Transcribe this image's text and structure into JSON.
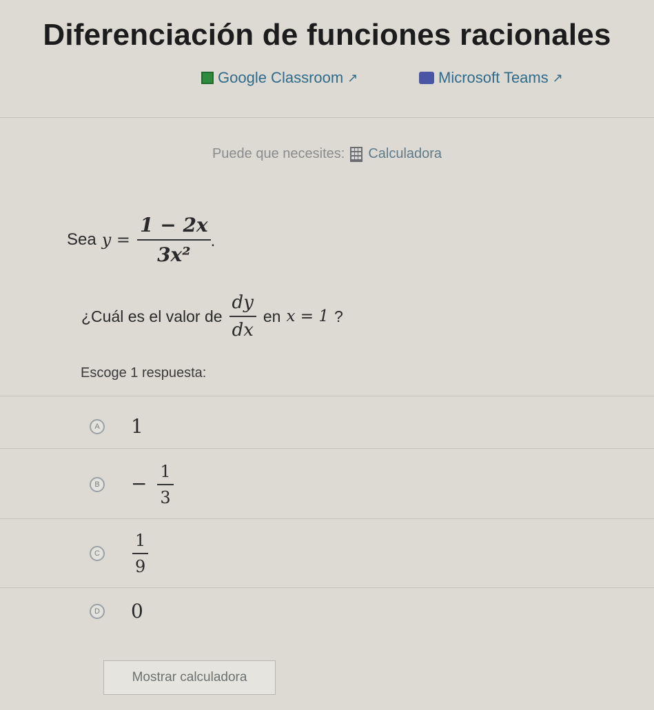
{
  "title": "Diferenciación de funciones racionales",
  "share": {
    "classroom_label": "Google Classroom",
    "teams_label": "Microsoft Teams"
  },
  "help": {
    "prefix": "Puede que necesites:",
    "calculator_label": "Calculadora"
  },
  "question": {
    "let_prefix": "Sea",
    "y_var": "y =",
    "y_numerator": "1 − 2x",
    "y_denominator": "3x²",
    "end_punct": ".",
    "ask_prefix": "¿Cuál es el valor de",
    "deriv_numerator": "dy",
    "deriv_denominator": "dx",
    "ask_middle": "en",
    "condition": "x = 1",
    "ask_suffix": "?"
  },
  "choose_label": "Escoge 1 respuesta:",
  "options": [
    {
      "letter": "A",
      "value": "1"
    },
    {
      "letter": "B",
      "sign": "−",
      "numerator": "1",
      "denominator": "3"
    },
    {
      "letter": "C",
      "numerator": "1",
      "denominator": "9"
    },
    {
      "letter": "D",
      "value": "0"
    }
  ],
  "show_calculator_button": "Mostrar calculadora",
  "colors": {
    "background": "#dcdad3",
    "link": "#2f6b8a",
    "classroom_icon": "#2e8b3e",
    "teams_icon": "#4b55a5"
  }
}
